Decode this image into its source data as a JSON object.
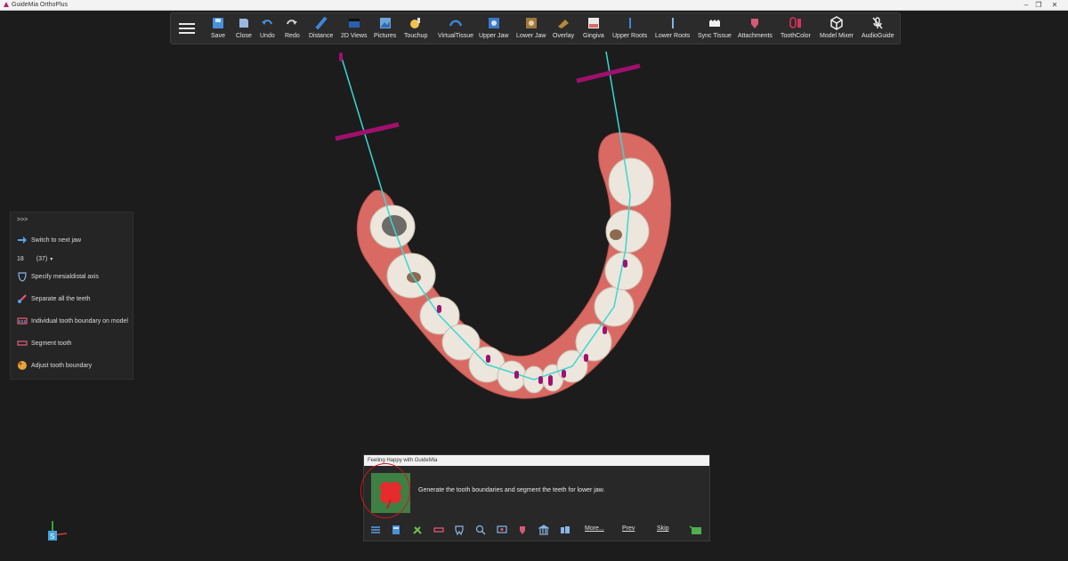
{
  "titlebar": {
    "app_title": "GuideMia OrthoPlus"
  },
  "toolbar": {
    "items": [
      {
        "label": "Save",
        "icon": "save-icon"
      },
      {
        "label": "Close",
        "icon": "close-file-icon"
      },
      {
        "label": "Undo",
        "icon": "undo-icon"
      },
      {
        "label": "Redo",
        "icon": "redo-icon"
      },
      {
        "label": "Distance",
        "icon": "ruler-icon"
      },
      {
        "label": "2D Views",
        "icon": "2d-views-icon"
      },
      {
        "label": "Pictures",
        "icon": "pictures-icon"
      },
      {
        "label": "Touchup",
        "icon": "touchup-icon"
      },
      {
        "label": "VirtualTissue",
        "icon": "virtual-tissue-icon"
      },
      {
        "label": "Upper Jaw",
        "icon": "upper-jaw-icon"
      },
      {
        "label": "Lower Jaw",
        "icon": "lower-jaw-icon"
      },
      {
        "label": "Overlay",
        "icon": "overlay-icon"
      },
      {
        "label": "Gingiva",
        "icon": "gingiva-icon"
      },
      {
        "label": "Upper Roots",
        "icon": "upper-roots-icon"
      },
      {
        "label": "Lower Roots",
        "icon": "lower-roots-icon"
      },
      {
        "label": "Sync Tissue",
        "icon": "sync-tissue-icon"
      },
      {
        "label": "Attachments",
        "icon": "attachments-icon"
      },
      {
        "label": "ToothColor",
        "icon": "tooth-color-icon"
      },
      {
        "label": "Model Mixer",
        "icon": "model-mixer-icon"
      },
      {
        "label": "AudioGuide",
        "icon": "audio-guide-icon"
      }
    ]
  },
  "left_panel": {
    "expand": ">>>",
    "switch_jaw": "Switch to next jaw",
    "tooth_number": "18",
    "tooth_alt": "(37)",
    "items": [
      {
        "label": "Specify mesialdistal axis",
        "icon": "tooth-axis-icon"
      },
      {
        "label": "Separate all the teeth",
        "icon": "separate-teeth-icon"
      },
      {
        "label": "Individual tooth boundary on model",
        "icon": "tooth-boundary-icon"
      },
      {
        "label": "Segment tooth",
        "icon": "segment-tooth-icon"
      },
      {
        "label": "Adjust tooth boundary",
        "icon": "adjust-boundary-icon"
      }
    ]
  },
  "guide": {
    "title": "Feeling Happy with GuideMia",
    "message": "Generate the tooth boundaries and segment the teeth for lower jaw.",
    "more": "More...",
    "prev": "Prev",
    "skip": "Skip"
  },
  "colors": {
    "accent_red": "#d2171c",
    "axis_line": "#3ad7d2",
    "marker": "#a0106e",
    "gum": "#d96a63"
  }
}
